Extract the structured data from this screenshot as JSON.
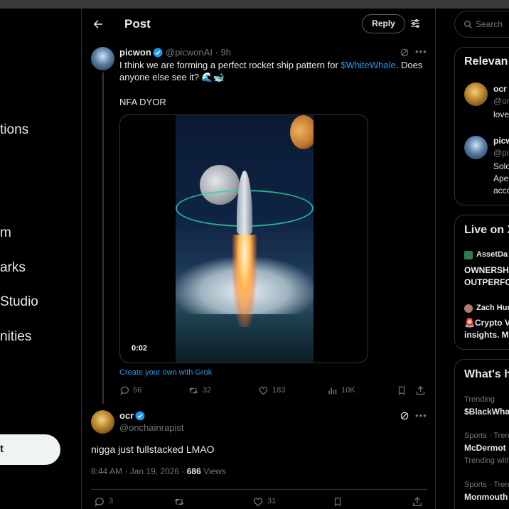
{
  "left_nav": {
    "items": [
      {
        "label": "tions"
      },
      {
        "label": "m"
      },
      {
        "label": "arks"
      },
      {
        "label": "Studio"
      },
      {
        "label": "nities"
      }
    ],
    "post_button": "t"
  },
  "header": {
    "title": "Post",
    "reply_button": "Reply"
  },
  "tweet": {
    "name": "picwon",
    "handle_time": "@picwonAI · 9h",
    "text_before": "I think we are forming a perfect rocket ship pattern for ",
    "cashtag": "$WhiteWhale",
    "text_after": ". Does anyone else see it? 🌊🐋",
    "text_2": "NFA DYOR",
    "video_time": "0:02",
    "grok_link": "Create your own with Grok",
    "actions": {
      "replies": "56",
      "reposts": "32",
      "likes": "183",
      "views": "10K"
    }
  },
  "reply": {
    "name": "ocr",
    "handle": "@onchainrapist",
    "text": "nigga just fullstacked LMAO",
    "time": "8:44 AM · Jan 19, 2026 · ",
    "views_count": "686",
    "views_label": " Views",
    "actions": {
      "replies": "3",
      "likes": "31"
    }
  },
  "right": {
    "search_placeholder": "Search",
    "relevant": {
      "title": "Relevan",
      "p1_name": "ocr",
      "p1_handle": "@onc",
      "p1_bio": "love",
      "p2_name": "picw",
      "p2_handle": "@pic",
      "p2_bio_1": "Solo",
      "p2_bio_2": "Ape",
      "p2_bio_3": "acco"
    },
    "live": {
      "title": "Live on X",
      "s1_user": "AssetDa",
      "s1_text_1": "OWNERSH",
      "s1_text_2": "OUTPERFO",
      "s2_user": "Zach Hun",
      "s2_text_1": "Crypto V",
      "s2_text_2": "insights. M"
    },
    "whats": {
      "title": "What's h",
      "t1_meta": "Trending",
      "t1_topic": "$BlackWha",
      "t2_meta": "Sports · Tren",
      "t2_topic": "McDermot",
      "t2_sub": "Trending with",
      "t3_meta": "Sports · Tren",
      "t3_topic": "Monmouth"
    }
  },
  "colors": {
    "background": "#000000",
    "accent": "#1d9bf0",
    "secondary_text": "#71767b",
    "border": "#2f3336"
  }
}
